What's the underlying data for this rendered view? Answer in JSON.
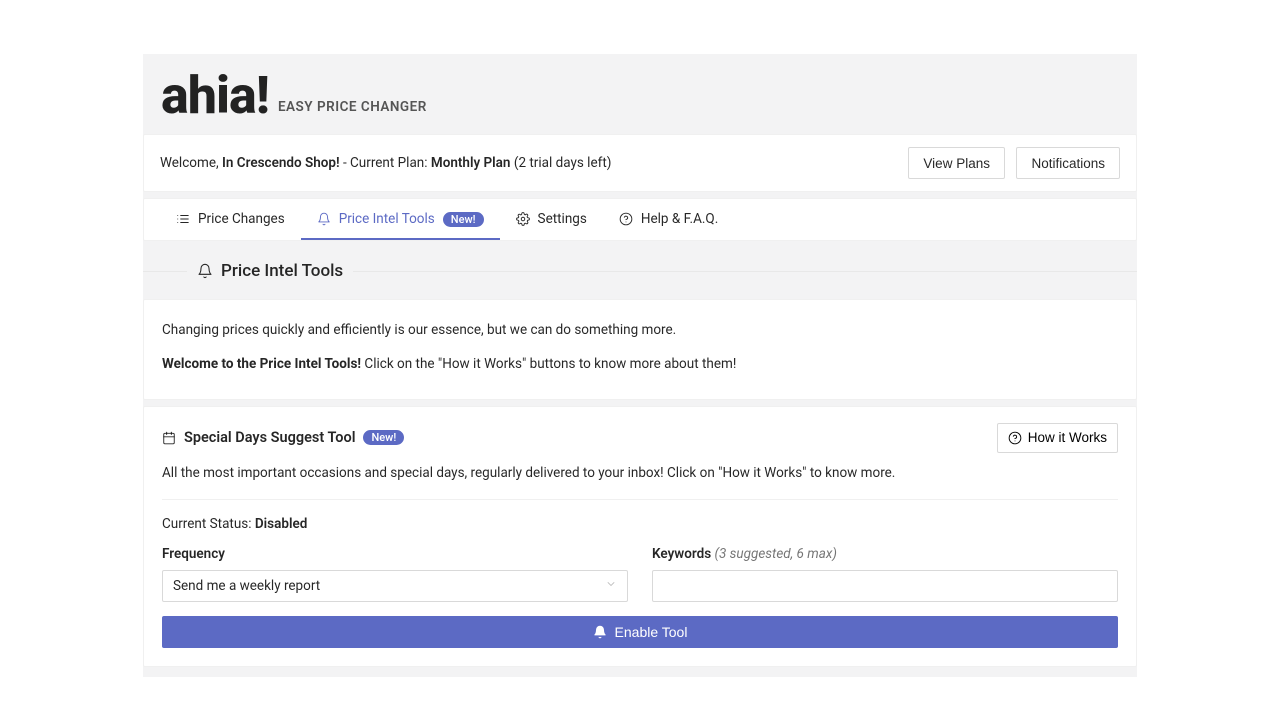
{
  "header": {
    "logo": "ahia!",
    "tagline": "EASY PRICE CHANGER"
  },
  "welcome": {
    "prefix": "Welcome, ",
    "shop": "In Crescendo Shop!",
    "plan_prefix": " - Current Plan: ",
    "plan": "Monthly Plan",
    "trial": " (2 trial days left)",
    "view_plans": "View Plans",
    "notifications": "Notifications"
  },
  "tabs": {
    "price_changes": "Price Changes",
    "price_intel": "Price Intel Tools",
    "new_badge": "New!",
    "settings": "Settings",
    "help": "Help & F.A.Q."
  },
  "section": {
    "title": "Price Intel Tools"
  },
  "intro": {
    "line1": "Changing prices quickly and efficiently is our essence, but we can do something more.",
    "line2_bold": "Welcome to the Price Intel Tools!",
    "line2_rest": " Click on the \"How it Works\" buttons to know more about them!"
  },
  "tool": {
    "title": "Special Days Suggest Tool",
    "new_badge": "New!",
    "how_it_works": "How it Works",
    "description": "All the most important occasions and special days, regularly delivered to your inbox! Click on \"How it Works\" to know more.",
    "status_label": "Current Status: ",
    "status_value": "Disabled",
    "frequency_label": "Frequency",
    "frequency_value": "Send me a weekly report",
    "keywords_label": "Keywords ",
    "keywords_hint": "(3 suggested, 6 max)",
    "keywords_value": "",
    "enable": "Enable Tool"
  }
}
